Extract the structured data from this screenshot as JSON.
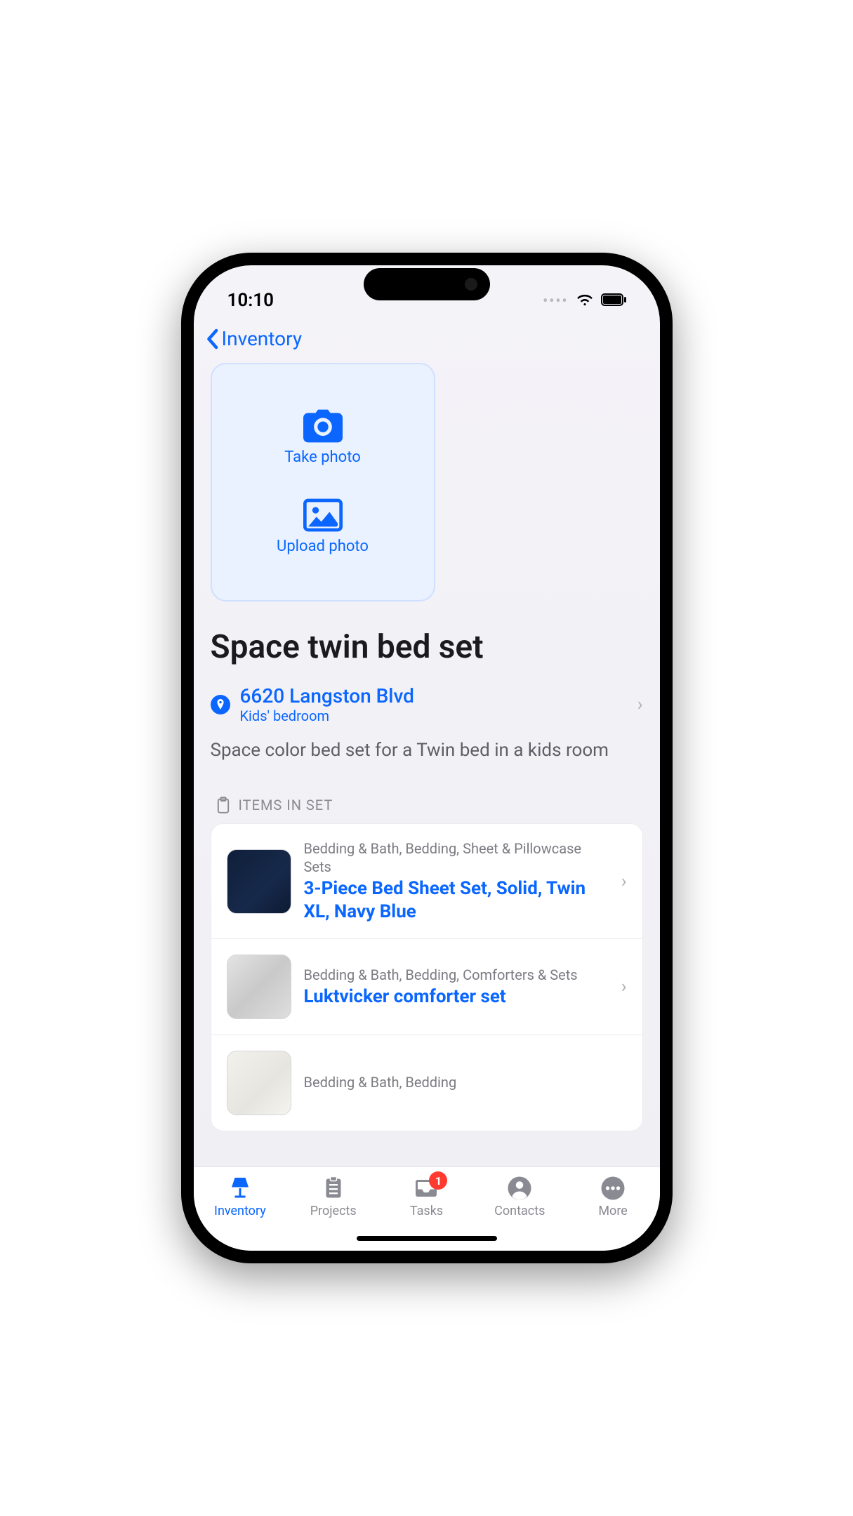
{
  "status": {
    "time": "10:10"
  },
  "nav": {
    "back_label": "Inventory"
  },
  "photo": {
    "take_label": "Take photo",
    "upload_label": "Upload photo"
  },
  "item": {
    "title": "Space twin bed set",
    "location_address": "6620 Langston Blvd",
    "location_room": "Kids' bedroom",
    "description": "Space color bed set for a Twin bed in a kids room"
  },
  "section": {
    "items_header": "ITEMS IN SET"
  },
  "set_items": [
    {
      "category": "Bedding & Bath, Bedding, Sheet & Pillowcase Sets",
      "name": "3-Piece Bed Sheet Set, Solid, Twin XL, Navy Blue"
    },
    {
      "category": "Bedding & Bath, Bedding, Comforters & Sets",
      "name": "Luktvicker comforter set"
    },
    {
      "category": "Bedding & Bath, Bedding",
      "name": ""
    }
  ],
  "tabs": {
    "inventory": "Inventory",
    "projects": "Projects",
    "tasks": "Tasks",
    "tasks_badge": "1",
    "contacts": "Contacts",
    "more": "More"
  }
}
